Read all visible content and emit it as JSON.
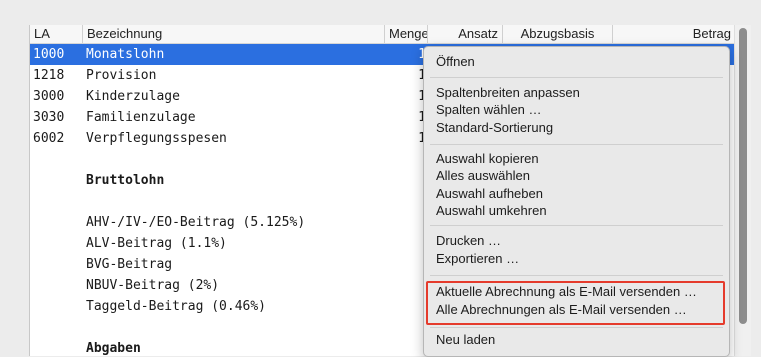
{
  "table": {
    "headers": {
      "la": "LA",
      "bez": "Bezeichnung",
      "menge": "Menge",
      "ansatz": "Ansatz",
      "basis": "Abzugsbasis",
      "betrag": "Betrag"
    },
    "rows": [
      {
        "la": "1000",
        "bez": "Monatslohn",
        "menge": "1"
      },
      {
        "la": "1218",
        "bez": "Provision",
        "menge": "1"
      },
      {
        "la": "3000",
        "bez": "Kinderzulage",
        "menge": "1"
      },
      {
        "la": "3030",
        "bez": "Familienzulage",
        "menge": "1"
      },
      {
        "la": "6002",
        "bez": "Verpflegungsspesen",
        "menge": "1"
      },
      {
        "la": "",
        "bez": "",
        "menge": ""
      },
      {
        "la": "",
        "bez": "Bruttolohn",
        "menge": ""
      },
      {
        "la": "",
        "bez": "",
        "menge": ""
      },
      {
        "la": "",
        "bez": "AHV-/IV-/EO-Beitrag (5.125%)",
        "menge": ""
      },
      {
        "la": "",
        "bez": "ALV-Beitrag (1.1%)",
        "menge": ""
      },
      {
        "la": "",
        "bez": "BVG-Beitrag",
        "menge": ""
      },
      {
        "la": "",
        "bez": "NBUV-Beitrag (2%)",
        "menge": ""
      },
      {
        "la": "",
        "bez": "Taggeld-Beitrag (0.46%)",
        "menge": ""
      },
      {
        "la": "",
        "bez": "",
        "menge": ""
      },
      {
        "la": "",
        "bez": "Abgaben",
        "menge": ""
      }
    ]
  },
  "menu": {
    "open": "Öffnen",
    "fit_columns": "Spaltenbreiten anpassen",
    "choose_columns": "Spalten wählen …",
    "default_sort": "Standard-Sortierung",
    "copy_selection": "Auswahl kopieren",
    "select_all": "Alles auswählen",
    "deselect": "Auswahl aufheben",
    "invert": "Auswahl umkehren",
    "print": "Drucken …",
    "export": "Exportieren …",
    "email_current": "Aktuelle Abrechnung als E-Mail versenden …",
    "email_all": "Alle Abrechnungen als E-Mail versenden …",
    "reload": "Neu laden"
  },
  "colors": {
    "selection": "#2b6fe0",
    "highlight_box": "#e53b2c"
  }
}
